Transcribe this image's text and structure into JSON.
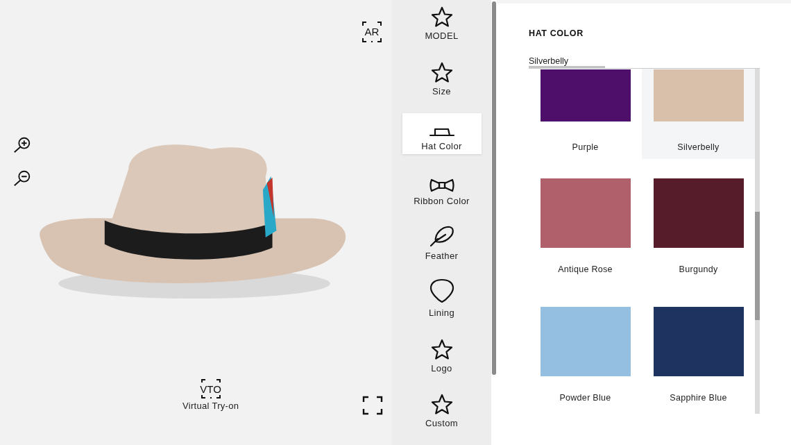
{
  "viewer": {
    "ar_label": "AR",
    "vto_label": "VTO",
    "vto_caption": "Virtual Try-on"
  },
  "options": [
    {
      "label": "MODEL",
      "kind": "star",
      "selected": false
    },
    {
      "label": "Size",
      "kind": "star",
      "selected": false
    },
    {
      "label": "Hat Color",
      "kind": "hat",
      "selected": true
    },
    {
      "label": "Ribbon Color",
      "kind": "bow",
      "selected": false
    },
    {
      "label": "Feather",
      "kind": "feather",
      "selected": false
    },
    {
      "label": "Lining",
      "kind": "lining",
      "selected": false
    },
    {
      "label": "Logo",
      "kind": "star",
      "selected": false
    },
    {
      "label": "Custom",
      "kind": "star",
      "selected": false
    }
  ],
  "panel": {
    "title": "HAT COLOR",
    "current": "Silverbelly",
    "swatches": [
      {
        "name": "Purple",
        "color": "#4e0f6a",
        "selected": false
      },
      {
        "name": "Silverbelly",
        "color": "#d8c0aa",
        "selected": true
      },
      {
        "name": "Antique Rose",
        "color": "#b0606a",
        "selected": false
      },
      {
        "name": "Burgundy",
        "color": "#561c2a",
        "selected": false
      },
      {
        "name": "Powder Blue",
        "color": "#94bfe0",
        "selected": false
      },
      {
        "name": "Sapphire Blue",
        "color": "#1f3360",
        "selected": false
      }
    ]
  }
}
